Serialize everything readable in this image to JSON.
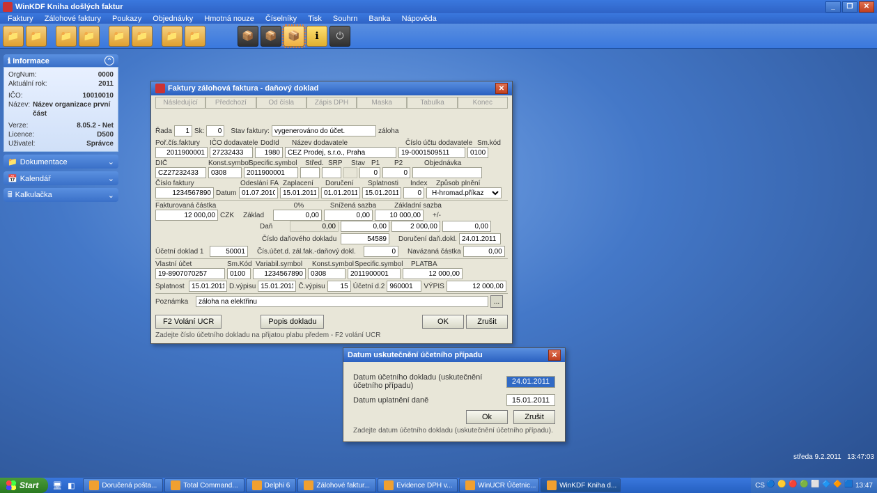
{
  "titlebar": {
    "title": "WinKDF Kniha došlých faktur"
  },
  "menubar": [
    "Faktury",
    "Zálohové faktury",
    "Poukazy",
    "Objednávky",
    "Hmotná nouze",
    "Číselníky",
    "Tisk",
    "Souhrn",
    "Banka",
    "Nápověda"
  ],
  "side": {
    "info_title": "Informace",
    "info": {
      "orgnum_l": "OrgNum:",
      "orgnum": "0000",
      "akt_l": "Aktuální rok:",
      "akt": "2011",
      "ico_l": "IČO:",
      "ico": "10010010",
      "nazev_l": "Název:",
      "nazev": "Název organizace první část",
      "verze_l": "Verze:",
      "verze": "8.05.2 - Net",
      "lic_l": "Licence:",
      "lic": "D500",
      "uziv_l": "Uživatel:",
      "uziv": "Správce"
    },
    "tools": [
      "Dokumentace",
      "Kalendář",
      "Kalkulačka"
    ]
  },
  "dlg_main": {
    "title": "Faktury zálohová faktura - daňový doklad",
    "tabs": [
      "Následující",
      "Předchozí",
      "Od čísla",
      "Zápis DPH",
      "Maska",
      "Tabulka",
      "Konec"
    ],
    "r1": {
      "rada_l": "Řada",
      "rada": "1",
      "sk_l": "Sk:",
      "sk": "0",
      "stav_l": "Stav faktury:",
      "stav": "vygenerováno do účet.",
      "zaloha": "záloha"
    },
    "r2": {
      "por_l": "Poř.čís.faktury",
      "por": "2011900001",
      "icod_l": "IČO dodavatele",
      "icod": "27232433",
      "dodid_l": "DodId",
      "dodid": "1980",
      "nazd_l": "Název dodavatele",
      "nazd": "ČEZ Prodej, s.r.o., Praha",
      "cucd_l": "Číslo účtu  dodavatele",
      "cucd": "19-0001509511",
      "smk_l": "Sm.kód",
      "smk": "0100"
    },
    "r3": {
      "dic_l": "DIČ",
      "dic": "CZ27232433",
      "ks_l": "Konst.symbol",
      "ks": "0308",
      "ss_l": "Specific.symbol",
      "ss": "2011900001",
      "str_l": "Střed.",
      "str": "",
      "srp_l": "SRP",
      "srp": "",
      "stav_l": "Stav",
      "p1_l": "P1",
      "p1": "0",
      "p2_l": "P2",
      "p2": "0",
      "obj_l": "Objednávka",
      "obj": ""
    },
    "r4": {
      "cf_l": "Číslo faktury",
      "cf": "1234567890",
      "dat_l": "Datum",
      "odes_l": "Odeslání FA",
      "odes": "01.07.2010",
      "zap_l": "Zaplacení",
      "zap": "15.01.2011",
      "dor_l": "Doručení",
      "dor": "01.01.2011",
      "spl_l": "Splatnosti",
      "spl": "15.01.2011",
      "idx_l": "Index",
      "idx": "0",
      "zp_l": "Způsob plnění",
      "zp": "H-hromad.příkaz"
    },
    "r5": {
      "fak_l": "Fakturovaná částka",
      "fak": "12 000,00",
      "czk": "CZK",
      "pct": "0%",
      "sniz_l": "Snížená sazba",
      "zakl_l": "Základní sazba",
      "zakl_l2": "Základ",
      "zakl0": "0,00",
      "zakl1": "0,00",
      "zakl2": "10 000,00",
      "pm": "+/-",
      "dan_l": "Daň",
      "dan0": "0,00",
      "dan1": "2 000,00",
      "dan2": "0,00"
    },
    "r6": {
      "cdd_l": "Číslo daňového dokladu",
      "cdd": "54589",
      "ddd_l": "Doručení daň.dokl.",
      "ddd": "24.01.2011"
    },
    "r7": {
      "ud_l": "Účetní doklad 1",
      "ud": "50001",
      "czfd_l": "Čís.účet.d. zál.fak.-daňový dokl.",
      "czfd": "0",
      "nav_l": "Navázaná částka",
      "nav": "0,00"
    },
    "r8": {
      "vu_l": "Vlastní účet",
      "vu": "19-8907070257",
      "smk_l": "Sm.Kód",
      "smk": "0100",
      "vs_l": "Variabil.symbol",
      "vs": "1234567890",
      "ks_l": "Konst.symbol",
      "ks": "0308",
      "ss_l": "Specific.symbol",
      "ss": "2011900001",
      "pl_l": "PLATBA",
      "pl": "12 000,00"
    },
    "r9": {
      "spl_l": "Splatnost",
      "spl": "15.01.2011",
      "dv_l": "D.výpisu",
      "dv": "15.01.2011",
      "cv_l": "Č.výpisu",
      "cv": "15",
      "ud_l": "Účetní d.2",
      "ud": "960001",
      "vyp_l": "VÝPIS",
      "vyp": "12 000,00"
    },
    "r10": {
      "poz_l": "Poznámka",
      "poz": "záloha na elektřinu"
    },
    "btns": {
      "f2": "F2 Volání UCR",
      "pop": "Popis dokladu",
      "ok": "OK",
      "zr": "Zrušit"
    },
    "hint": "Zadejte číslo účetního dokladu na přijatou plabu předem  - F2 volání UCR"
  },
  "dlg_date": {
    "title": "Datum uskutečnění účetního případu",
    "l1": "Datum účetního dokladu (uskutečnění účetního případu)",
    "v1": "24.01.2011",
    "l2": "Datum uplatnění daně",
    "v2": "15.01.2011",
    "ok": "Ok",
    "zr": "Zrušit",
    "hint": "Zadejte datum účetního dokladu (uskutečnění účetního případu)."
  },
  "clock_strip": {
    "date": "středa 9.2.2011",
    "time": "13:47:03"
  },
  "taskbar": {
    "start": "Start",
    "tasks": [
      {
        "label": "Doručená pošta..."
      },
      {
        "label": "Total Command..."
      },
      {
        "label": "Delphi 6"
      },
      {
        "label": "Zálohové faktur..."
      },
      {
        "label": "Evidence DPH v..."
      },
      {
        "label": "WinUCR Účetnic..."
      },
      {
        "label": "WinKDF Kniha d...",
        "active": true
      }
    ],
    "lang": "CS",
    "clock": "13:47"
  }
}
